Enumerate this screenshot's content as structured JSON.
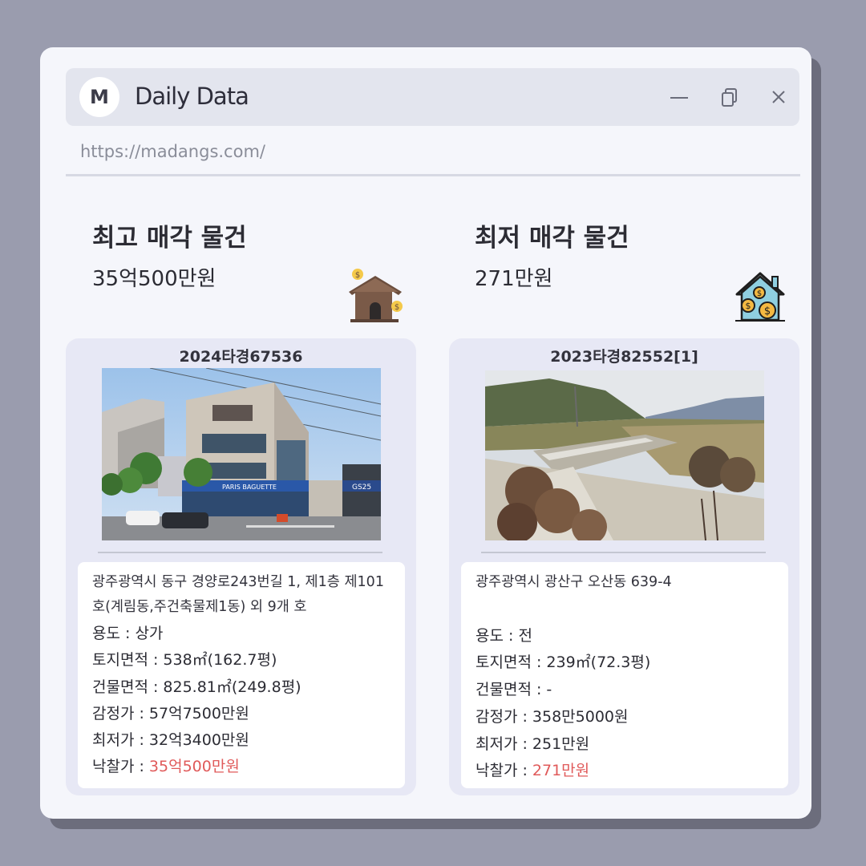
{
  "window": {
    "avatar_letter": "M",
    "title": "Daily Data",
    "url": "https://madangs.com/"
  },
  "icons": {
    "minimize": "minimize-icon",
    "restore": "restore-icon",
    "close": "close-icon",
    "highest": "house-money-brown-icon",
    "lowest": "house-money-blue-icon"
  },
  "highest": {
    "heading": "최고 매각 물건",
    "price": "35억500만원",
    "case_no": "2024타경67536",
    "address": "광주광역시 동구 경양로243번길 1, 제1층 제101호(계림동,주건축물제1동) 외 9개 호",
    "usage": "용도 : 상가",
    "land_area": "토지면적 : 538㎡(162.7평)",
    "building_area": "건물면적 : 825.81㎡(249.8평)",
    "appraisal": "감정가 : 57억7500만원",
    "minimum": "최저가 : 32억3400만원",
    "winning_label": "낙찰가 : ",
    "winning_value": "35억500만원",
    "photo_signs": [
      "PARIS BAGUETTE",
      "GS25"
    ]
  },
  "lowest": {
    "heading": "최저 매각 물건",
    "price": "271만원",
    "case_no": "2023타경82552[1]",
    "address": "광주광역시 광산구 오산동 639-4",
    "usage": "용도 : 전",
    "land_area": "토지면적 : 239㎡(72.3평)",
    "building_area": "건물면적 : -",
    "appraisal": "감정가 : 358만5000원",
    "minimum": "최저가 : 251만원",
    "winning_label": "낙찰가 : ",
    "winning_value": "271만원"
  },
  "colors": {
    "background": "#9a9cae",
    "window": "#f5f6fb",
    "card": "#e7e8f5",
    "highlight": "#e05a5a"
  }
}
